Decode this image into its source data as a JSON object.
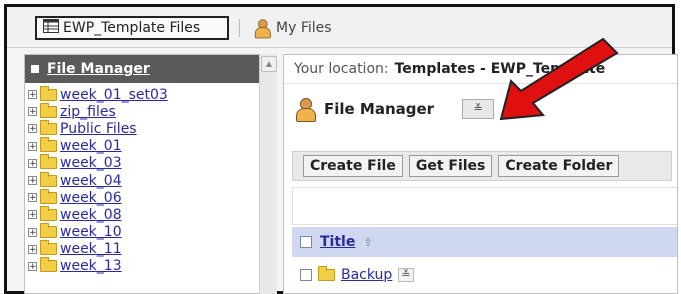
{
  "tabs": {
    "active_label": "EWP_Template Files",
    "inactive_label": "My Files"
  },
  "left_panel": {
    "title": "File Manager",
    "items": [
      {
        "label": "week_01_set03"
      },
      {
        "label": "zip_files"
      },
      {
        "label": "Public Files"
      },
      {
        "label": "week_01"
      },
      {
        "label": "week_03"
      },
      {
        "label": "week_04"
      },
      {
        "label": "week_06"
      },
      {
        "label": "week_08"
      },
      {
        "label": "week_10"
      },
      {
        "label": "week_11"
      },
      {
        "label": "week_13"
      }
    ]
  },
  "right_panel": {
    "location_prefix": "Your location:",
    "location_path": "Templates - EWP_Template",
    "title": "File Manager",
    "toolbar": {
      "create_file": "Create File",
      "get_files": "Get Files",
      "create_folder": "Create Folder"
    },
    "table": {
      "header_title": "Title",
      "rows": [
        {
          "name": "Backup"
        }
      ]
    }
  },
  "colors": {
    "arrow": "#e01010",
    "header_row": "#cfd8f0",
    "link": "#2a2aa0",
    "left_header": "#5a5a5a"
  },
  "icons": [
    "table-icon",
    "person-icon",
    "folder-icon",
    "dropdown-icon",
    "sort-up-icon",
    "red-arrow-annotation"
  ]
}
